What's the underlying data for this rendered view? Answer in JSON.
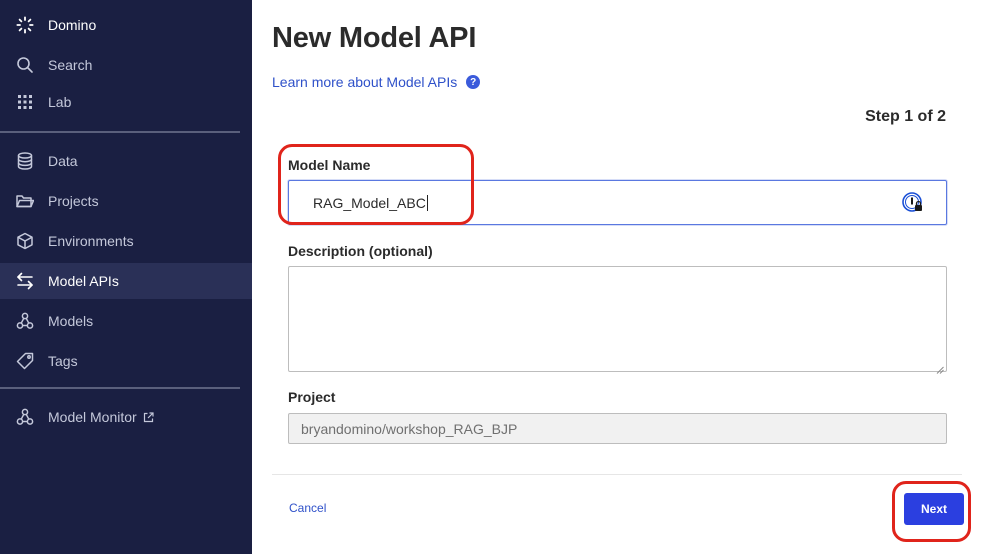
{
  "sidebar": {
    "brand": "Domino",
    "items": [
      {
        "label": "Search",
        "icon": "search-icon"
      },
      {
        "label": "Lab",
        "icon": "grid-icon"
      },
      {
        "label": "Data",
        "icon": "database-icon"
      },
      {
        "label": "Projects",
        "icon": "folder-icon"
      },
      {
        "label": "Environments",
        "icon": "cube-icon"
      },
      {
        "label": "Model APIs",
        "icon": "swap-arrows-icon",
        "active": true
      },
      {
        "label": "Models",
        "icon": "models-icon"
      },
      {
        "label": "Tags",
        "icon": "tag-icon"
      },
      {
        "label": "Model Monitor",
        "icon": "models-icon",
        "external": true
      }
    ]
  },
  "main": {
    "title": "New Model API",
    "learn_more": "Learn more about Model APIs",
    "help_icon": "?",
    "step": "Step 1 of 2",
    "form": {
      "model_name_label": "Model Name",
      "model_name_value": "RAG_Model_ABC",
      "description_label": "Description (optional)",
      "description_value": "",
      "project_label": "Project",
      "project_value": "bryandomino/workshop_RAG_BJP"
    },
    "cancel_label": "Cancel",
    "next_label": "Next"
  },
  "colors": {
    "sidebar_bg": "#1a1f42",
    "sidebar_active_bg": "#2a3057",
    "link": "#2f51c9",
    "primary_button": "#2b3fe0",
    "highlight": "#e0241b"
  }
}
